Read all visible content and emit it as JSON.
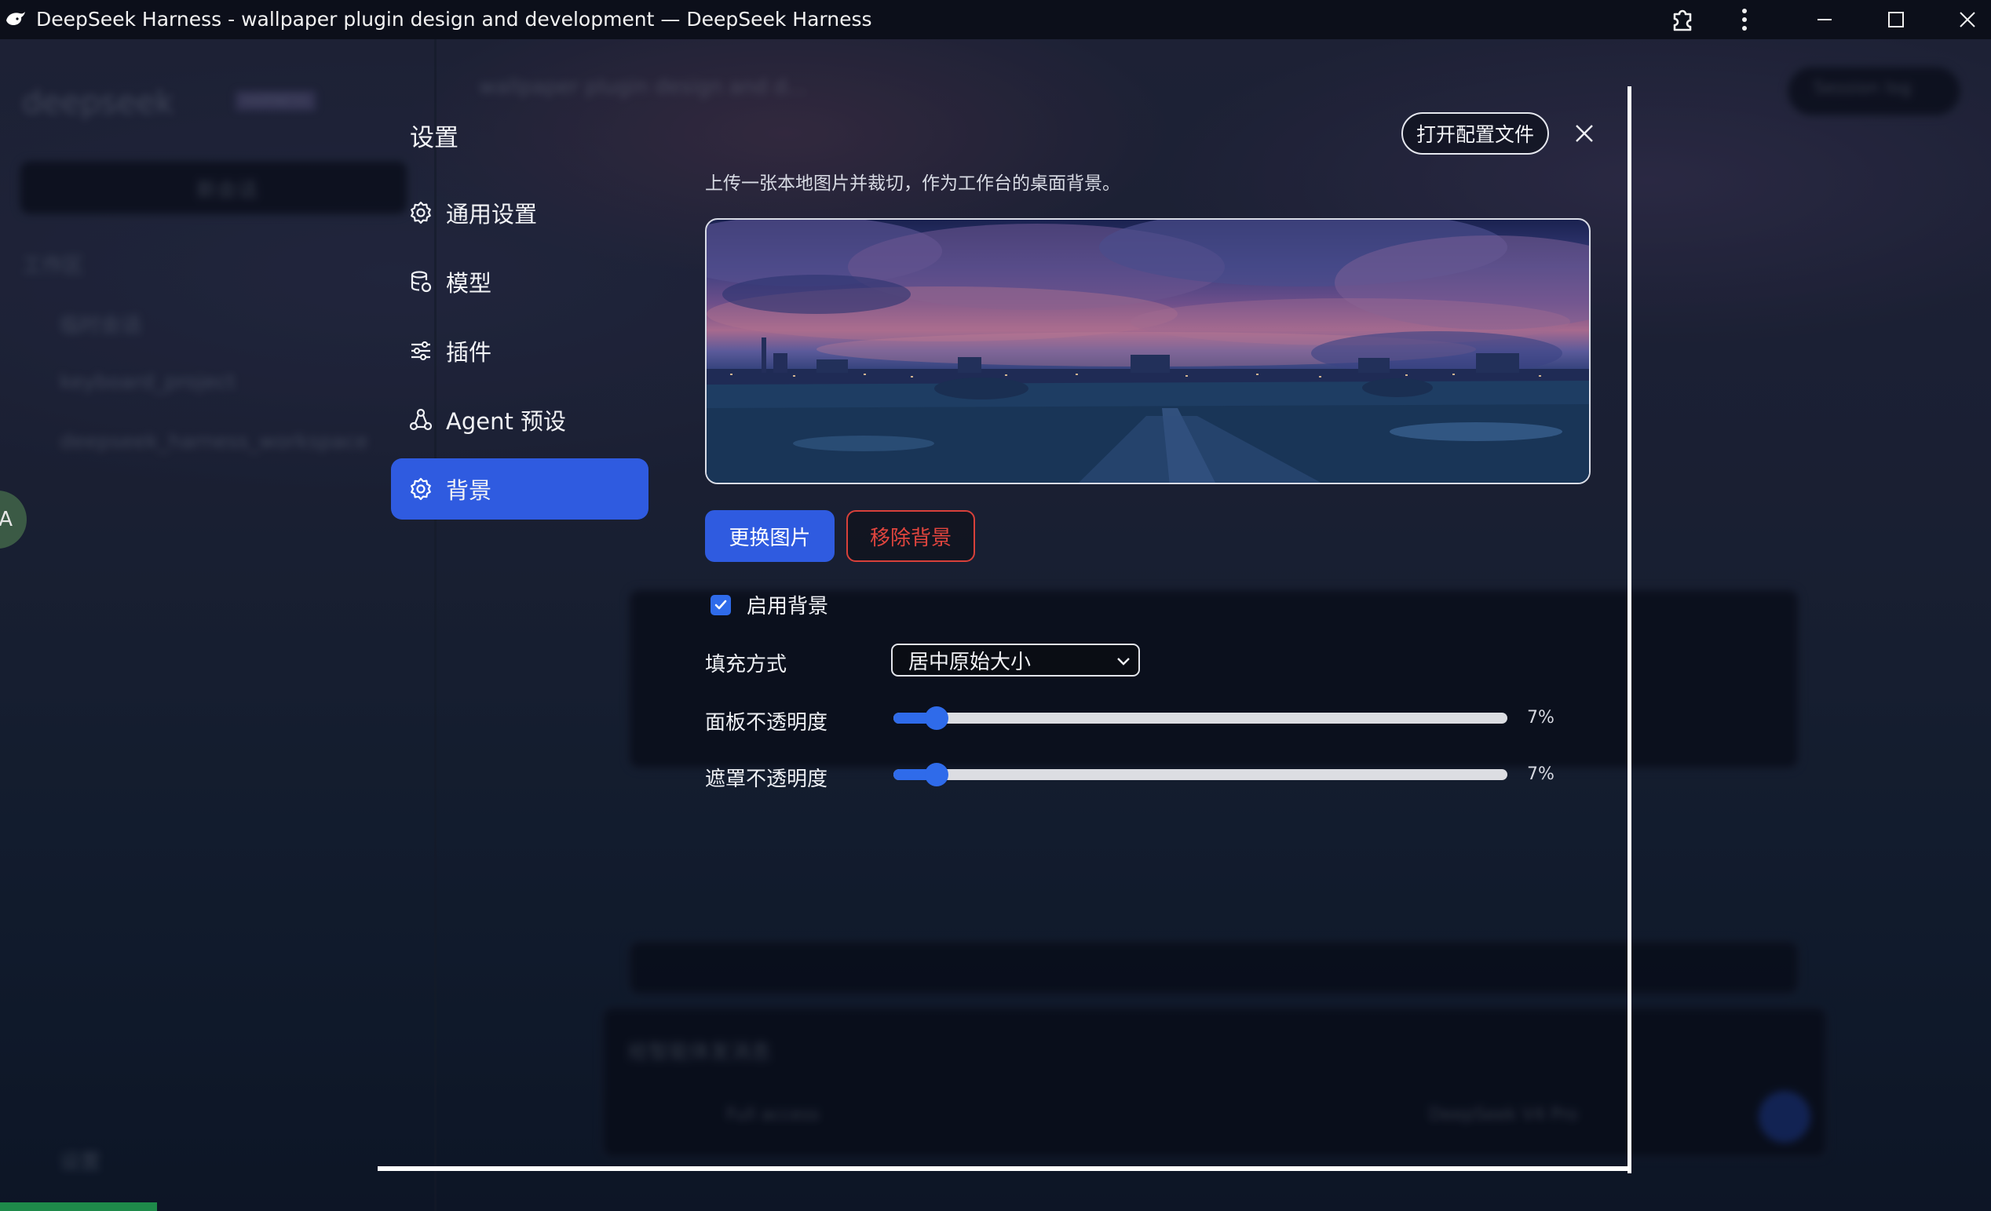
{
  "window": {
    "title": "DeepSeek Harness - wallpaper plugin design and development — DeepSeek Harness"
  },
  "background_app": {
    "brand": "deepseek",
    "brand_badge": "HARNESS",
    "new_chat": "新会话",
    "workspace_header": "工作区",
    "workspace_items": [
      "临时会话",
      "keyboard_project",
      "deepseek_harness_workspace"
    ],
    "chat_title": "wallpaper plugin design and d...",
    "session_log": "Session log",
    "settings_link": "设置",
    "composer_placeholder": "给智能体发消息",
    "access_mode": "Full access",
    "model_name": "DeepSeek V4 Pro",
    "left_tab_letter": "A"
  },
  "settings": {
    "title": "设置",
    "open_config_label": "打开配置文件",
    "nav": [
      {
        "label": "通用设置",
        "icon": "gear-icon"
      },
      {
        "label": "模型",
        "icon": "database-icon"
      },
      {
        "label": "插件",
        "icon": "sliders-icon"
      },
      {
        "label": "Agent 预设",
        "icon": "agent-icon"
      },
      {
        "label": "背景",
        "icon": "gear-icon",
        "active": true
      }
    ],
    "background": {
      "description": "上传一张本地图片并裁切，作为工作台的桌面背景。",
      "change_image_label": "更换图片",
      "remove_background_label": "移除背景",
      "enable_label": "启用背景",
      "enabled": true,
      "fill_mode_label": "填充方式",
      "fill_mode_value": "居中原始大小",
      "panel_opacity_label": "面板不透明度",
      "panel_opacity_value": "7%",
      "panel_opacity_level": 0.07,
      "mask_opacity_label": "遮罩不透明度",
      "mask_opacity_value": "7%",
      "mask_opacity_level": 0.07
    }
  },
  "colors": {
    "accent": "#2f5be0",
    "danger": "#e0453e",
    "titlebar": "#0c0f1a"
  }
}
